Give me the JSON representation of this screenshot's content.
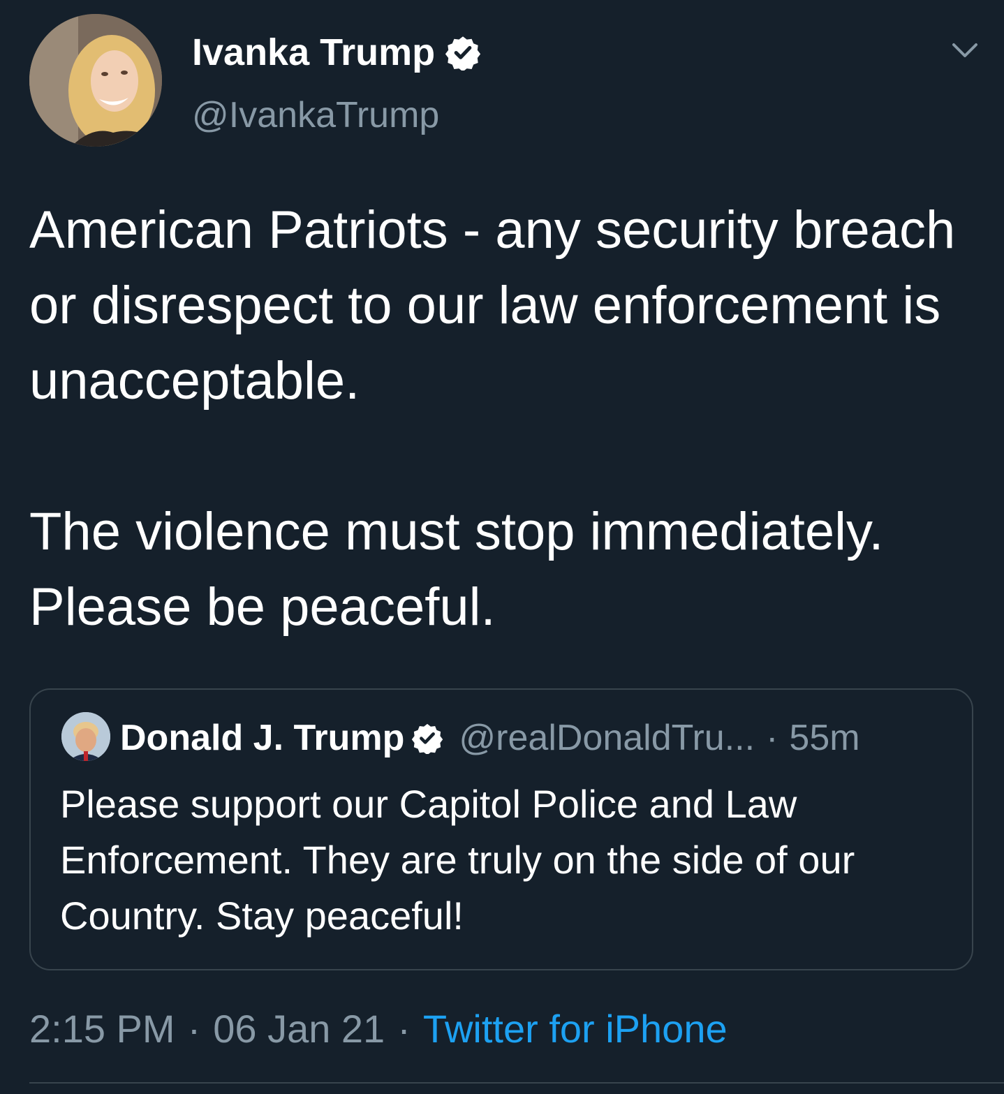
{
  "author": {
    "display_name": "Ivanka Trump",
    "handle": "@IvankaTrump",
    "verified_icon": "verified-badge-icon",
    "avatar_icon": "profile-photo"
  },
  "menu": {
    "icon": "chevron-down-icon"
  },
  "tweet": {
    "text": "American Patriots - any security breach or disrespect to our law enforcement is unacceptable.\n\nThe violence must stop immediately. Please be peaceful."
  },
  "quoted_tweet": {
    "display_name": "Donald J. Trump",
    "handle": "@realDonaldTru...",
    "separator": "·",
    "time": "55m",
    "text": "Please support our Capitol Police and Law Enforcement. They are truly on the side of our Country. Stay peaceful!"
  },
  "meta": {
    "time": "2:15 PM",
    "separator": "·",
    "date": "06 Jan 21",
    "source": "Twitter for iPhone"
  },
  "colors": {
    "background": "#15202b",
    "secondary_text": "#8899a6",
    "link": "#1da1f2",
    "border": "#38444d"
  }
}
